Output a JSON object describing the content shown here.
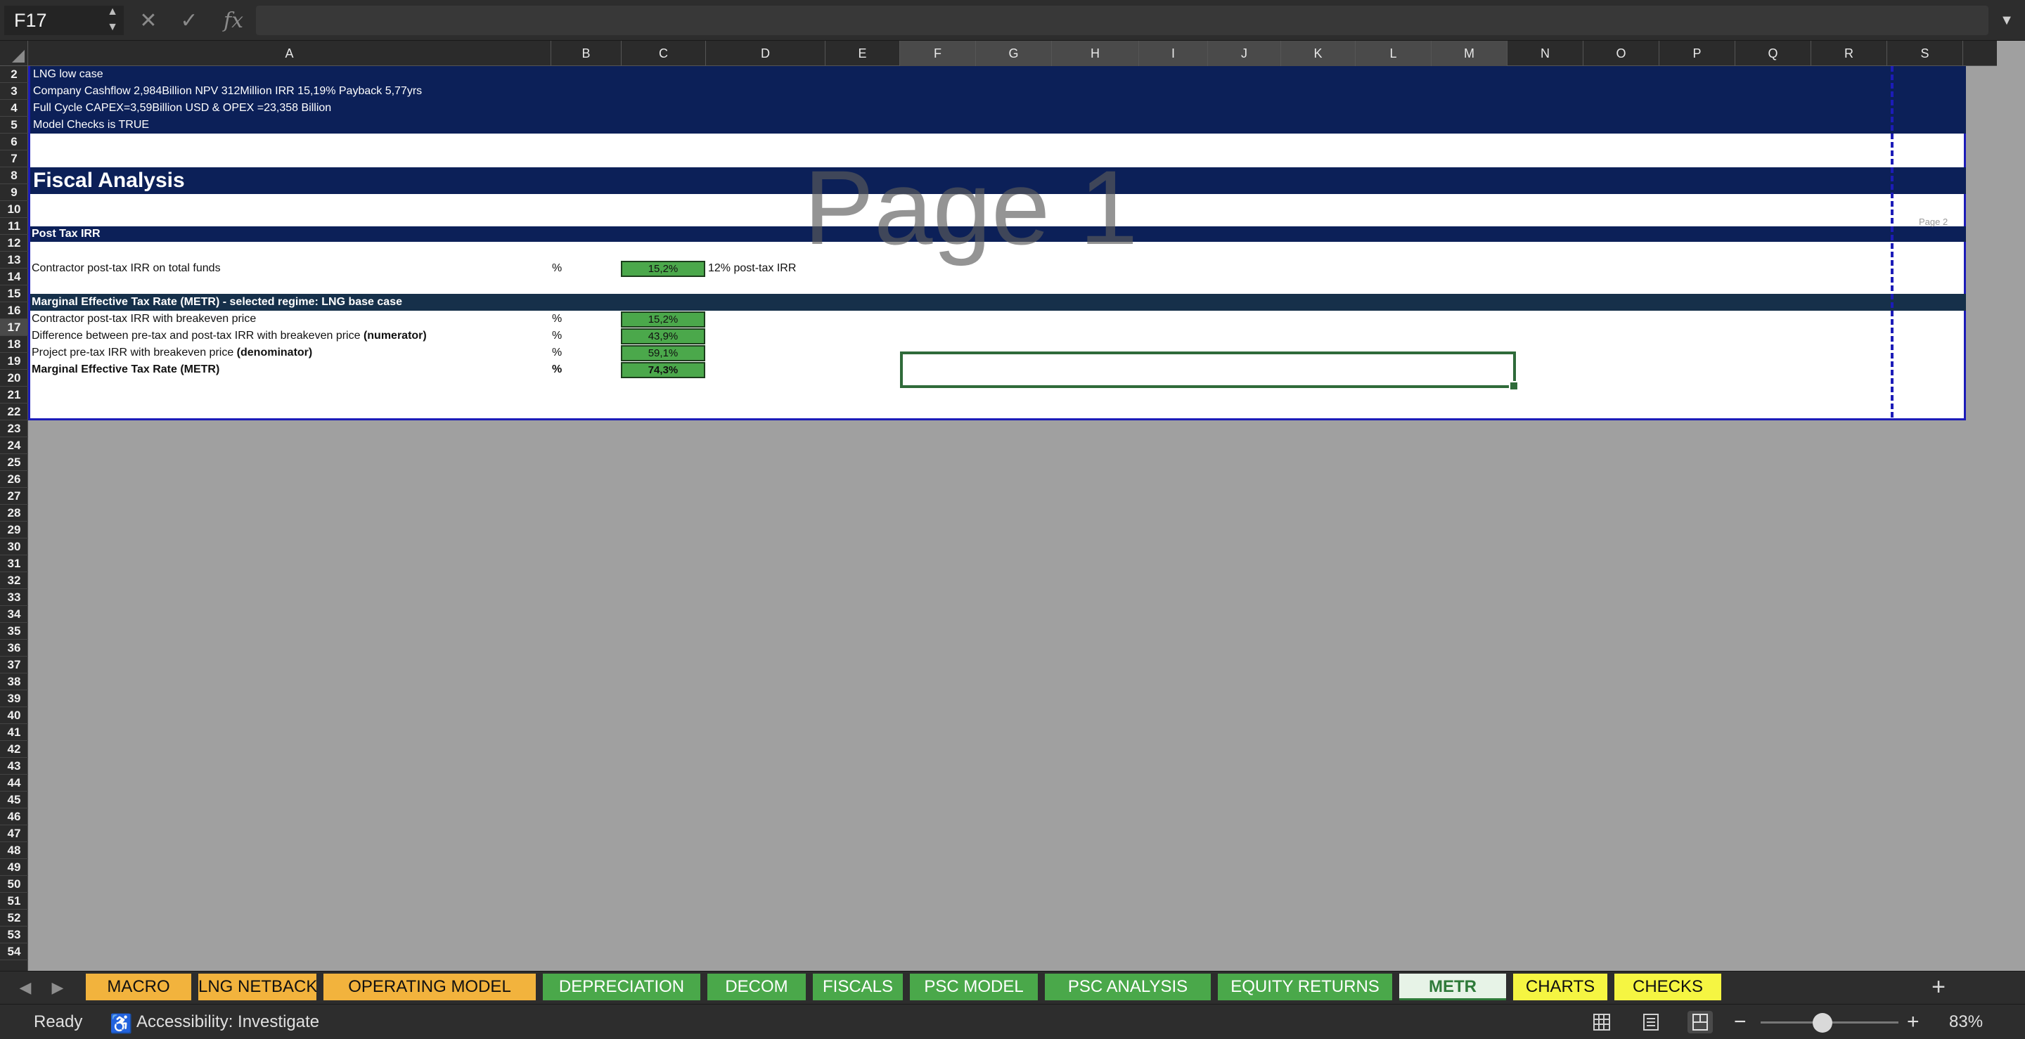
{
  "formula_bar": {
    "name_box": "F17",
    "stepper": "▲\n▼",
    "cancel_glyph": "✕",
    "confirm_glyph": "✓",
    "fx_label": "fx",
    "formula_value": "",
    "expand_glyph": "▼"
  },
  "columns": [
    "A",
    "B",
    "C",
    "D",
    "E",
    "F",
    "G",
    "H",
    "I",
    "J",
    "K",
    "L",
    "M",
    "N",
    "O",
    "P",
    "Q",
    "R",
    "S"
  ],
  "selected_columns": [
    "F",
    "G",
    "H",
    "I",
    "J",
    "K",
    "L",
    "M"
  ],
  "rows": [
    "2",
    "3",
    "4",
    "5",
    "6",
    "7",
    "8",
    "9",
    "10",
    "11",
    "12",
    "13",
    "14",
    "15",
    "16",
    "17",
    "18",
    "19",
    "20",
    "21",
    "22",
    "23",
    "24",
    "25",
    "26",
    "27",
    "28",
    "29",
    "30",
    "31",
    "32",
    "33",
    "34",
    "35",
    "36",
    "37",
    "38",
    "39",
    "40",
    "41",
    "42",
    "43",
    "44",
    "45",
    "46",
    "47",
    "48",
    "49",
    "50",
    "51",
    "52",
    "53",
    "54"
  ],
  "selected_row": "17",
  "sheet": {
    "row2": "LNG low  case",
    "row3": "Company Cashflow   2,984Billion  NPV 312Million  IRR 15,19% Payback 5,77yrs",
    "row4": "Full Cycle CAPEX=3,59Billion USD & OPEX =23,358 Billion",
    "row5": "Model Checks is TRUE",
    "title": "Fiscal Analysis",
    "section_post_tax": "Post Tax IRR",
    "row13_label": "Contractor post-tax IRR on total funds",
    "row13_unit": "%",
    "row13_value": "15,2%",
    "row13_note": "12% post-tax IRR",
    "section_metr": "Marginal Effective Tax Rate (METR) - selected regime: LNG base  case",
    "row16_label": "Contractor post-tax IRR with breakeven price",
    "row16_unit": "%",
    "row16_value": "15,2%",
    "row17_label": "Difference between pre-tax and post-tax IRR with breakeven price ",
    "row17_label_bold": "(numerator)",
    "row17_unit": "%",
    "row17_value": "43,9%",
    "row18_label": "Project pre-tax IRR with breakeven price ",
    "row18_label_bold": "(denominator)",
    "row18_unit": "%",
    "row18_value": "59,1%",
    "row19_label": "Marginal Effective Tax Rate (METR)",
    "row19_unit": "%",
    "row19_value": "74,3%",
    "page_watermark": "Page 1",
    "page2_label": "Page 2"
  },
  "tabs": [
    {
      "label": "MACRO",
      "color": "#f2b33d"
    },
    {
      "label": "LNG NETBACK PRICE",
      "color": "#f2b33d"
    },
    {
      "label": "OPERATING MODEL",
      "color": "#f2b33d"
    },
    {
      "label": "DEPRECIATION",
      "color": "#4aa84a"
    },
    {
      "label": "DECOM",
      "color": "#4aa84a"
    },
    {
      "label": "FISCALS",
      "color": "#4aa84a"
    },
    {
      "label": "PSC MODEL",
      "color": "#4aa84a"
    },
    {
      "label": "PSC ANALYSIS",
      "color": "#4aa84a"
    },
    {
      "label": "EQUITY RETURNS",
      "color": "#4aa84a"
    },
    {
      "label": "METR",
      "color": "#e7f3e7",
      "active": true
    },
    {
      "label": "CHARTS",
      "color": "#f5f542"
    },
    {
      "label": "CHECKS",
      "color": "#f5f542"
    }
  ],
  "tab_nav": {
    "prev": "◀",
    "next": "▶",
    "add": "+"
  },
  "status": {
    "ready": "Ready",
    "accessibility": "Accessibility: Investigate",
    "accessibility_glyph": "♿",
    "zoom_minus": "−",
    "zoom_plus": "+",
    "zoom": "83%",
    "zoom_fraction": 0.45
  }
}
